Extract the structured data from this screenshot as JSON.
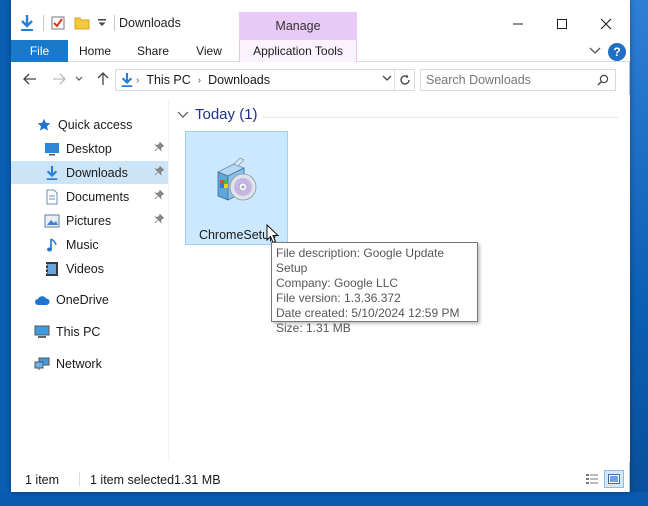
{
  "window": {
    "title": "Downloads",
    "contextual_tab": "Manage",
    "controls": {
      "minimize": "minimize",
      "maximize": "maximize",
      "close": "close"
    }
  },
  "ribbon": {
    "tabs": [
      {
        "label": "File"
      },
      {
        "label": "Home"
      },
      {
        "label": "Share"
      },
      {
        "label": "View"
      },
      {
        "label": "Application Tools"
      }
    ],
    "help_label": "?"
  },
  "address": {
    "crumbs": [
      "This PC",
      "Downloads"
    ],
    "search_placeholder": "Search Downloads"
  },
  "nav_pane": {
    "quick_access": "Quick access",
    "items": [
      {
        "label": "Desktop",
        "pinned": true
      },
      {
        "label": "Downloads",
        "pinned": true
      },
      {
        "label": "Documents",
        "pinned": true
      },
      {
        "label": "Pictures",
        "pinned": true
      },
      {
        "label": "Music",
        "pinned": false
      },
      {
        "label": "Videos",
        "pinned": false
      }
    ],
    "onedrive": "OneDrive",
    "this_pc": "This PC",
    "network": "Network"
  },
  "content": {
    "group_label": "Today (1)",
    "file": {
      "name": "ChromeSetup"
    },
    "tooltip": {
      "description": "File description: Google Update Setup",
      "company": "Company: Google LLC",
      "version": "File version: 1.3.36.372",
      "created": "Date created: 5/10/2024 12:59 PM",
      "size": "Size: 1.31 MB"
    }
  },
  "status": {
    "item_count": "1 item",
    "selection": "1 item selected",
    "selection_size": "1.31 MB"
  },
  "colors": {
    "file_tab": "#1979ca",
    "manage_tab": "#e9c9f5",
    "selection": "#cce8ff",
    "group_header": "#1e3287"
  }
}
